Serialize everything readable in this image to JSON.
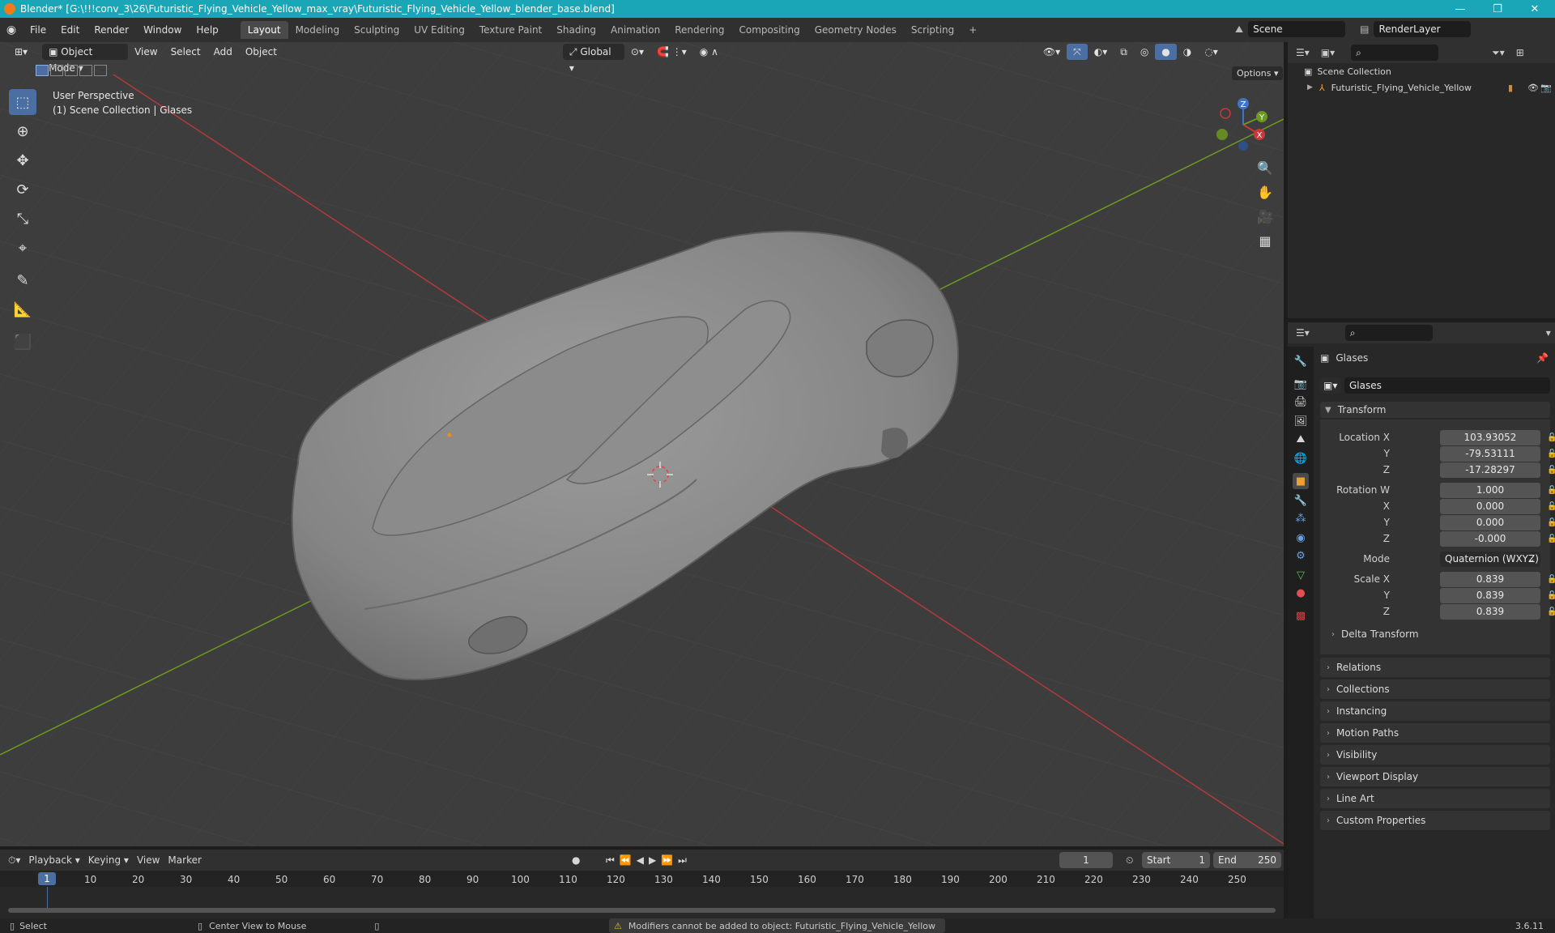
{
  "window": {
    "title": "Blender* [G:\\!!!conv_3\\26\\Futuristic_Flying_Vehicle_Yellow_max_vray\\Futuristic_Flying_Vehicle_Yellow_blender_base.blend]",
    "minimize": "—",
    "maximize": "❐",
    "close": "✕"
  },
  "menu": {
    "file": "File",
    "edit": "Edit",
    "render": "Render",
    "window": "Window",
    "help": "Help"
  },
  "workspaces": [
    "Layout",
    "Modeling",
    "Sculpting",
    "UV Editing",
    "Texture Paint",
    "Shading",
    "Animation",
    "Rendering",
    "Compositing",
    "Geometry Nodes",
    "Scripting"
  ],
  "workspace_add": "+",
  "scene": {
    "name": "Scene",
    "render_layer": "RenderLayer"
  },
  "viewport": {
    "mode": "Object Mode",
    "view": "View",
    "select": "Select",
    "add": "Add",
    "object": "Object",
    "orientation": "Global",
    "options": "Options",
    "overlay_line1": "User Perspective",
    "overlay_line2": "(1) Scene Collection | Glases",
    "gizmo": {
      "z": "Z",
      "y": "Y",
      "x": "X"
    }
  },
  "outliner": {
    "root": "Scene Collection",
    "items": [
      {
        "label": "Futuristic_Flying_Vehicle_Yellow"
      }
    ]
  },
  "properties": {
    "object_name": "Glases",
    "data_name": "Glases",
    "transform_header": "Transform",
    "location": {
      "label_x": "Location X",
      "label_y": "Y",
      "label_z": "Z",
      "x": "103.93052",
      "y": "-79.53111",
      "z": "-17.28297"
    },
    "rotation": {
      "label_w": "Rotation W",
      "label_x": "X",
      "label_y": "Y",
      "label_z": "Z",
      "w": "1.000",
      "x": "0.000",
      "y": "0.000",
      "z": "-0.000"
    },
    "mode_label": "Mode",
    "mode_value": "Quaternion (WXYZ)",
    "scale": {
      "label_x": "Scale X",
      "label_y": "Y",
      "label_z": "Z",
      "x": "0.839",
      "y": "0.839",
      "z": "0.839"
    },
    "delta": "Delta Transform",
    "panels": [
      "Relations",
      "Collections",
      "Instancing",
      "Motion Paths",
      "Visibility",
      "Viewport Display",
      "Line Art",
      "Custom Properties"
    ]
  },
  "timeline": {
    "playback": "Playback",
    "keying": "Keying",
    "view": "View",
    "marker": "Marker",
    "current_frame": "1",
    "start_label": "Start",
    "start": "1",
    "end_label": "End",
    "end": "250",
    "ruler_current": "1",
    "ruler_ticks": [
      "10",
      "20",
      "30",
      "40",
      "50",
      "60",
      "70",
      "80",
      "90",
      "100",
      "110",
      "120",
      "130",
      "140",
      "150",
      "160",
      "170",
      "180",
      "190",
      "200",
      "210",
      "220",
      "230",
      "240",
      "250"
    ]
  },
  "status": {
    "select": "Select",
    "center": "Center View to Mouse",
    "warning": "Modifiers cannot be added to object: Futuristic_Flying_Vehicle_Yellow",
    "version": "3.6.11"
  },
  "colors": {
    "titlebar": "#1aa6b7",
    "accent": "#4b6fa3",
    "x_axis": "#c83a3a",
    "y_axis": "#6c9a1f",
    "z_axis": "#3d74c9",
    "warning": "#f1b431"
  }
}
